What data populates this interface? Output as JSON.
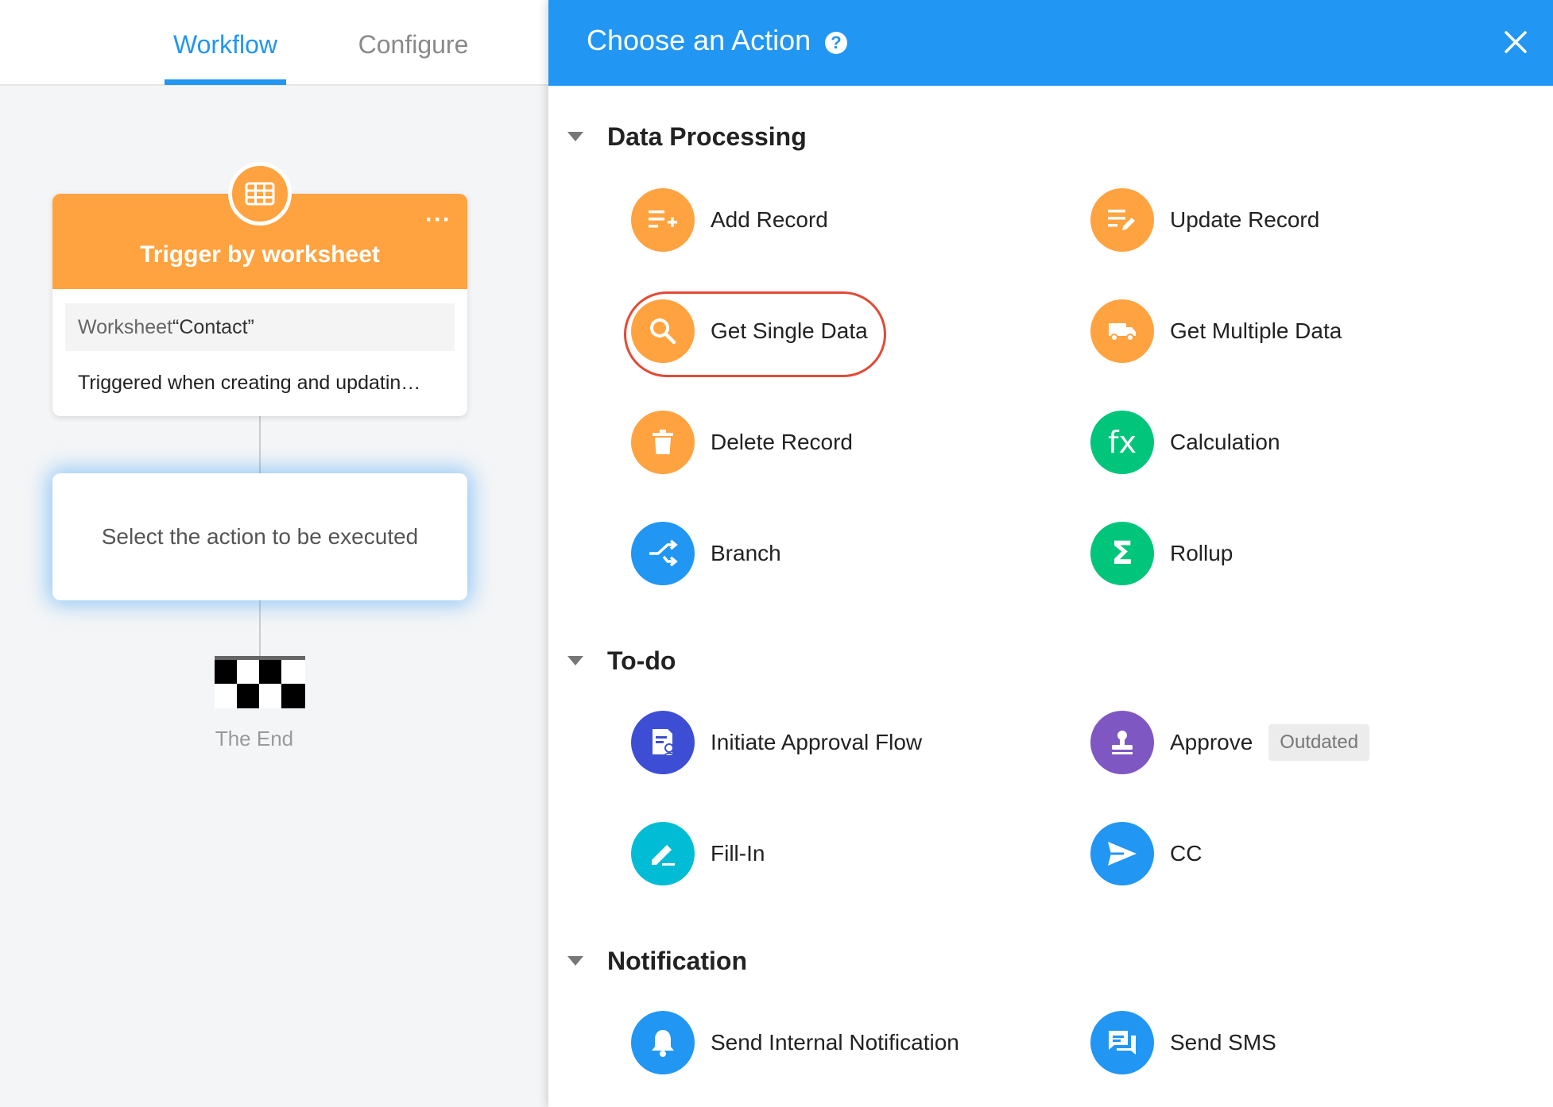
{
  "tabs": {
    "workflow": "Workflow",
    "configure": "Configure"
  },
  "trigger": {
    "more": "···",
    "title": "Trigger by worksheet",
    "worksheet_key": "Worksheet",
    "worksheet_value": "“Contact”",
    "description": "Triggered when creating and updatin…"
  },
  "action_placeholder": "Select the action to be executed",
  "end_label": "The End",
  "panel": {
    "title": "Choose an Action",
    "help": "?",
    "sections": {
      "data_processing": {
        "title": "Data Processing",
        "items": {
          "add_record": "Add Record",
          "update_record": "Update Record",
          "get_single_data": "Get Single Data",
          "get_multiple_data": "Get Multiple Data",
          "delete_record": "Delete Record",
          "calculation": "Calculation",
          "calculation_glyph": "fx",
          "branch": "Branch",
          "rollup": "Rollup",
          "rollup_glyph": "Σ"
        }
      },
      "todo": {
        "title": "To-do",
        "items": {
          "initiate_approval_flow": "Initiate Approval Flow",
          "approve": "Approve",
          "approve_badge": "Outdated",
          "fill_in": "Fill-In",
          "cc": "CC"
        }
      },
      "notification": {
        "title": "Notification",
        "items": {
          "send_internal_notification": "Send Internal Notification",
          "send_sms": "Send SMS"
        }
      }
    }
  },
  "colors": {
    "primary_blue": "#2196f3",
    "orange": "#ffa340",
    "green": "#00c57a",
    "indigo": "#3d4ed4",
    "purple": "#7e57c2",
    "teal": "#00bcd4",
    "highlight_red": "#e34a36"
  }
}
